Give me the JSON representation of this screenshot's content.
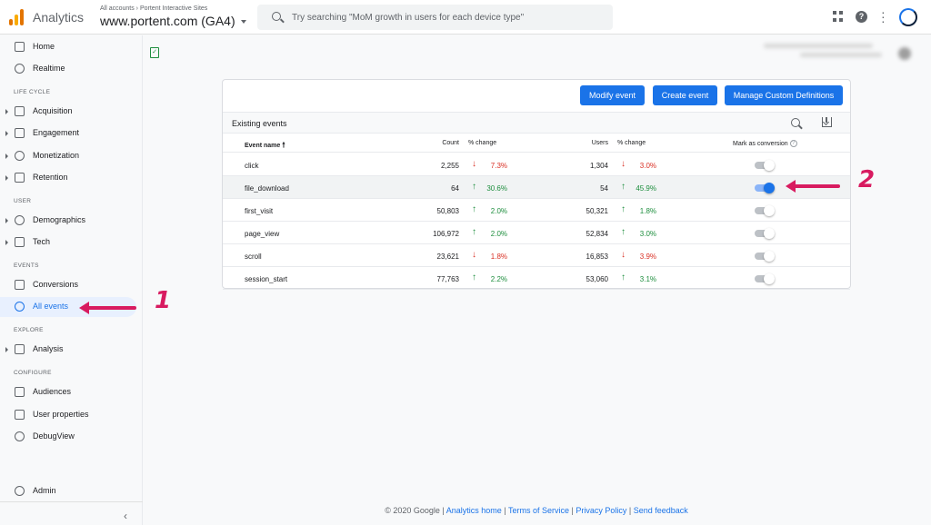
{
  "header": {
    "app_name": "Analytics",
    "breadcrumb": "All accounts  ›  Portent Interactive Sites",
    "property": "www.portent.com (GA4)",
    "search_placeholder": "Try searching \"MoM growth in users for each device type\""
  },
  "sidebar": {
    "items": [
      {
        "label": "Home",
        "icon": "home-icon"
      },
      {
        "label": "Realtime",
        "icon": "clock-icon"
      },
      {
        "label": "Acquisition",
        "icon": "acquisition-icon"
      },
      {
        "label": "Engagement",
        "icon": "tag-icon"
      },
      {
        "label": "Monetization",
        "icon": "dollar-icon"
      },
      {
        "label": "Retention",
        "icon": "retention-icon"
      },
      {
        "label": "Demographics",
        "icon": "globe-icon"
      },
      {
        "label": "Tech",
        "icon": "devices-icon"
      },
      {
        "label": "Conversions",
        "icon": "flag-icon"
      },
      {
        "label": "All events",
        "icon": "touch-icon"
      },
      {
        "label": "Analysis",
        "icon": "analysis-icon"
      },
      {
        "label": "Audiences",
        "icon": "audiences-icon"
      },
      {
        "label": "User properties",
        "icon": "user-icon"
      },
      {
        "label": "DebugView",
        "icon": "bug-icon"
      },
      {
        "label": "Admin",
        "icon": "gear-icon"
      }
    ],
    "sections": [
      "LIFE CYCLE",
      "USER",
      "EVENTS",
      "EXPLORE",
      "CONFIGURE"
    ]
  },
  "card": {
    "buttons": {
      "modify": "Modify event",
      "create": "Create event",
      "manage": "Manage Custom Definitions"
    },
    "subtitle": "Existing events",
    "columns": {
      "name": "Event name",
      "count": "Count",
      "count_change": "% change",
      "users": "Users",
      "users_change": "% change",
      "conversion": "Mark as conversion"
    },
    "rows": [
      {
        "name": "click",
        "count": "2,255",
        "count_dir": "down",
        "count_change": "7.3%",
        "users": "1,304",
        "users_dir": "down",
        "users_change": "3.0%",
        "conversion": false
      },
      {
        "name": "file_download",
        "count": "64",
        "count_dir": "up",
        "count_change": "30.6%",
        "users": "54",
        "users_dir": "up",
        "users_change": "45.9%",
        "conversion": true
      },
      {
        "name": "first_visit",
        "count": "50,803",
        "count_dir": "up",
        "count_change": "2.0%",
        "users": "50,321",
        "users_dir": "up",
        "users_change": "1.8%",
        "conversion": false
      },
      {
        "name": "page_view",
        "count": "106,972",
        "count_dir": "up",
        "count_change": "2.0%",
        "users": "52,834",
        "users_dir": "up",
        "users_change": "3.0%",
        "conversion": false
      },
      {
        "name": "scroll",
        "count": "23,621",
        "count_dir": "down",
        "count_change": "1.8%",
        "users": "16,853",
        "users_dir": "down",
        "users_change": "3.9%",
        "conversion": false
      },
      {
        "name": "session_start",
        "count": "77,763",
        "count_dir": "up",
        "count_change": "2.2%",
        "users": "53,060",
        "users_dir": "up",
        "users_change": "3.1%",
        "conversion": false
      }
    ]
  },
  "annotations": {
    "one": "1",
    "two": "2"
  },
  "footer": {
    "copyright": "© 2020 Google",
    "links": [
      "Analytics home",
      "Terms of Service",
      "Privacy Policy",
      "Send feedback"
    ]
  },
  "colors": {
    "accent": "#1a73e8",
    "up": "#1e8e3e",
    "down": "#d93025",
    "annotation": "#d81b60"
  }
}
